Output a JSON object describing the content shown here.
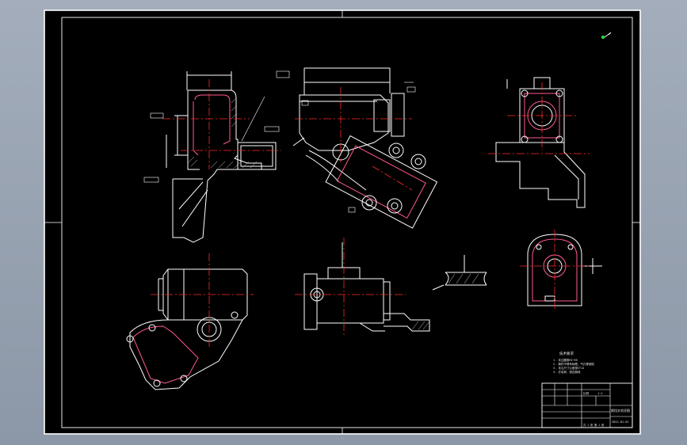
{
  "app": {
    "viewport_background": "#97a2b1",
    "sheet_background": "#000000",
    "line_color": "#ffffff",
    "centerline_color": "#ff2a2a",
    "dimension_color": "#ffffff"
  },
  "icons": {
    "ucs": "ucs-axis-icon"
  },
  "notes": {
    "heading": "技术要求",
    "lines": [
      "1. 未注圆角R3~R5",
      "2. 铸件不得有砂眼、气孔等缺陷",
      "3. 未注尺寸公差按IT14",
      "4. 去毛刺，锐边倒钝"
    ]
  },
  "title_block": {
    "part_name": "换挡叉毛坯图",
    "drawing_code": "CDSJ-01-01",
    "scale_label": "比例",
    "scale_value": "1:1",
    "sheet_label": "共 1 张 第 1 张"
  }
}
